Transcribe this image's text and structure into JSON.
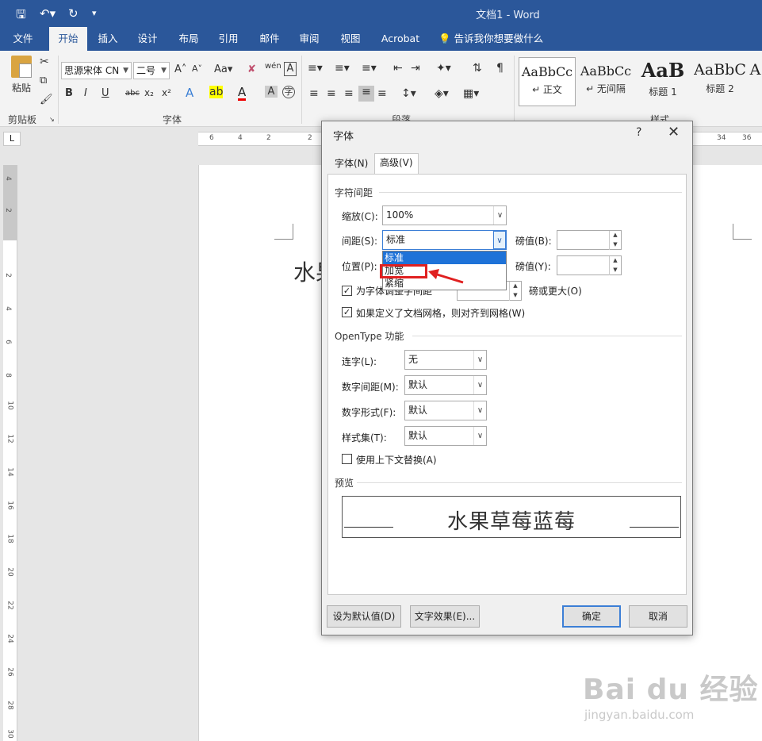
{
  "titlebar": {
    "title": "文档1  -  Word"
  },
  "ribbon_tabs": [
    "文件",
    "开始",
    "插入",
    "设计",
    "布局",
    "引用",
    "邮件",
    "审阅",
    "视图",
    "Acrobat"
  ],
  "tell_me": "告诉我你想要做什么",
  "clipboard": {
    "paste": "粘贴",
    "group": "剪贴板"
  },
  "font_group": {
    "font_name": "思源宋体 CN",
    "font_size": "二号",
    "case": "Aa",
    "wen": "wén",
    "group": "字体"
  },
  "paragraph_group": {
    "group": "段落"
  },
  "styles_group": {
    "group": "样式",
    "items": [
      {
        "sample": "AaBbCc",
        "name": "↵ 正文"
      },
      {
        "sample": "AaBbCc",
        "name": "↵ 无间隔"
      },
      {
        "sample": "AaB",
        "name": "标题 1"
      },
      {
        "sample": "AaBbC",
        "name": "标题 2"
      },
      {
        "sample": "A",
        "name": ""
      }
    ]
  },
  "ruler": {
    "corner": "L",
    "h_numbers": [
      "6",
      "4",
      "2",
      "2",
      "34",
      "36"
    ],
    "v_numbers": [
      "4",
      "2",
      "2",
      "4",
      "6",
      "8",
      "10",
      "12",
      "14",
      "16",
      "18",
      "20",
      "22",
      "24",
      "26",
      "28",
      "30"
    ]
  },
  "document": {
    "visible_text": "水果"
  },
  "dialog": {
    "title": "字体",
    "help": "?",
    "close": "✕",
    "tabs": [
      "字体(N)",
      "高级(V)"
    ],
    "active_tab": "高级(V)",
    "char_spacing": {
      "section": "字符间距",
      "scale_label": "缩放(C):",
      "scale_value": "100%",
      "spacing_label": "间距(S):",
      "spacing_value": "标准",
      "spacing_pt_label": "磅值(B):",
      "position_label": "位置(P):",
      "position_pt_label": "磅值(Y):",
      "kerning_label": "为字体调整字间距",
      "kerning_suffix": "磅或更大(O)",
      "grid_label": "如果定义了文档网格，则对齐到网格(W)",
      "dropdown_options": [
        "标准",
        "加宽",
        "紧缩"
      ],
      "dropdown_selected": "标准",
      "highlighted_option": "加宽"
    },
    "opentype": {
      "section": "OpenType 功能",
      "ligatures_label": "连字(L):",
      "ligatures_value": "无",
      "num_spacing_label": "数字间距(M):",
      "num_spacing_value": "默认",
      "num_form_label": "数字形式(F):",
      "num_form_value": "默认",
      "style_set_label": "样式集(T):",
      "style_set_value": "默认",
      "contextual_label": "使用上下文替换(A)"
    },
    "preview": {
      "section": "预览",
      "text": "水果草莓蓝莓"
    },
    "buttons": {
      "set_default": "设为默认值(D)",
      "text_effects": "文字效果(E)...",
      "ok": "确定",
      "cancel": "取消"
    }
  },
  "watermark": {
    "brand": "Bai du 经验",
    "url": "jingyan.baidu.com"
  }
}
